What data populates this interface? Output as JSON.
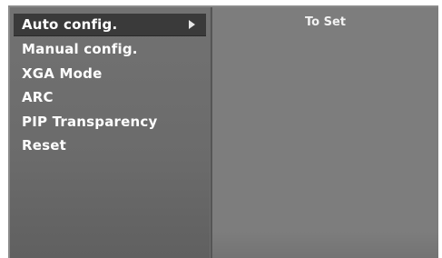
{
  "menu": {
    "items": [
      {
        "label": "Auto config.",
        "selected": true
      },
      {
        "label": "Manual config.",
        "selected": false
      },
      {
        "label": "XGA Mode",
        "selected": false
      },
      {
        "label": "ARC",
        "selected": false
      },
      {
        "label": "PIP Transparency",
        "selected": false
      },
      {
        "label": "Reset",
        "selected": false
      }
    ],
    "selected_submenu_arrow_icon": "right-arrow-icon"
  },
  "detail_panel": {
    "title": "To Set"
  },
  "colors": {
    "panel_bg": "#6e6e6e",
    "selected_bg": "#3a3a3a",
    "text": "#ffffff"
  }
}
